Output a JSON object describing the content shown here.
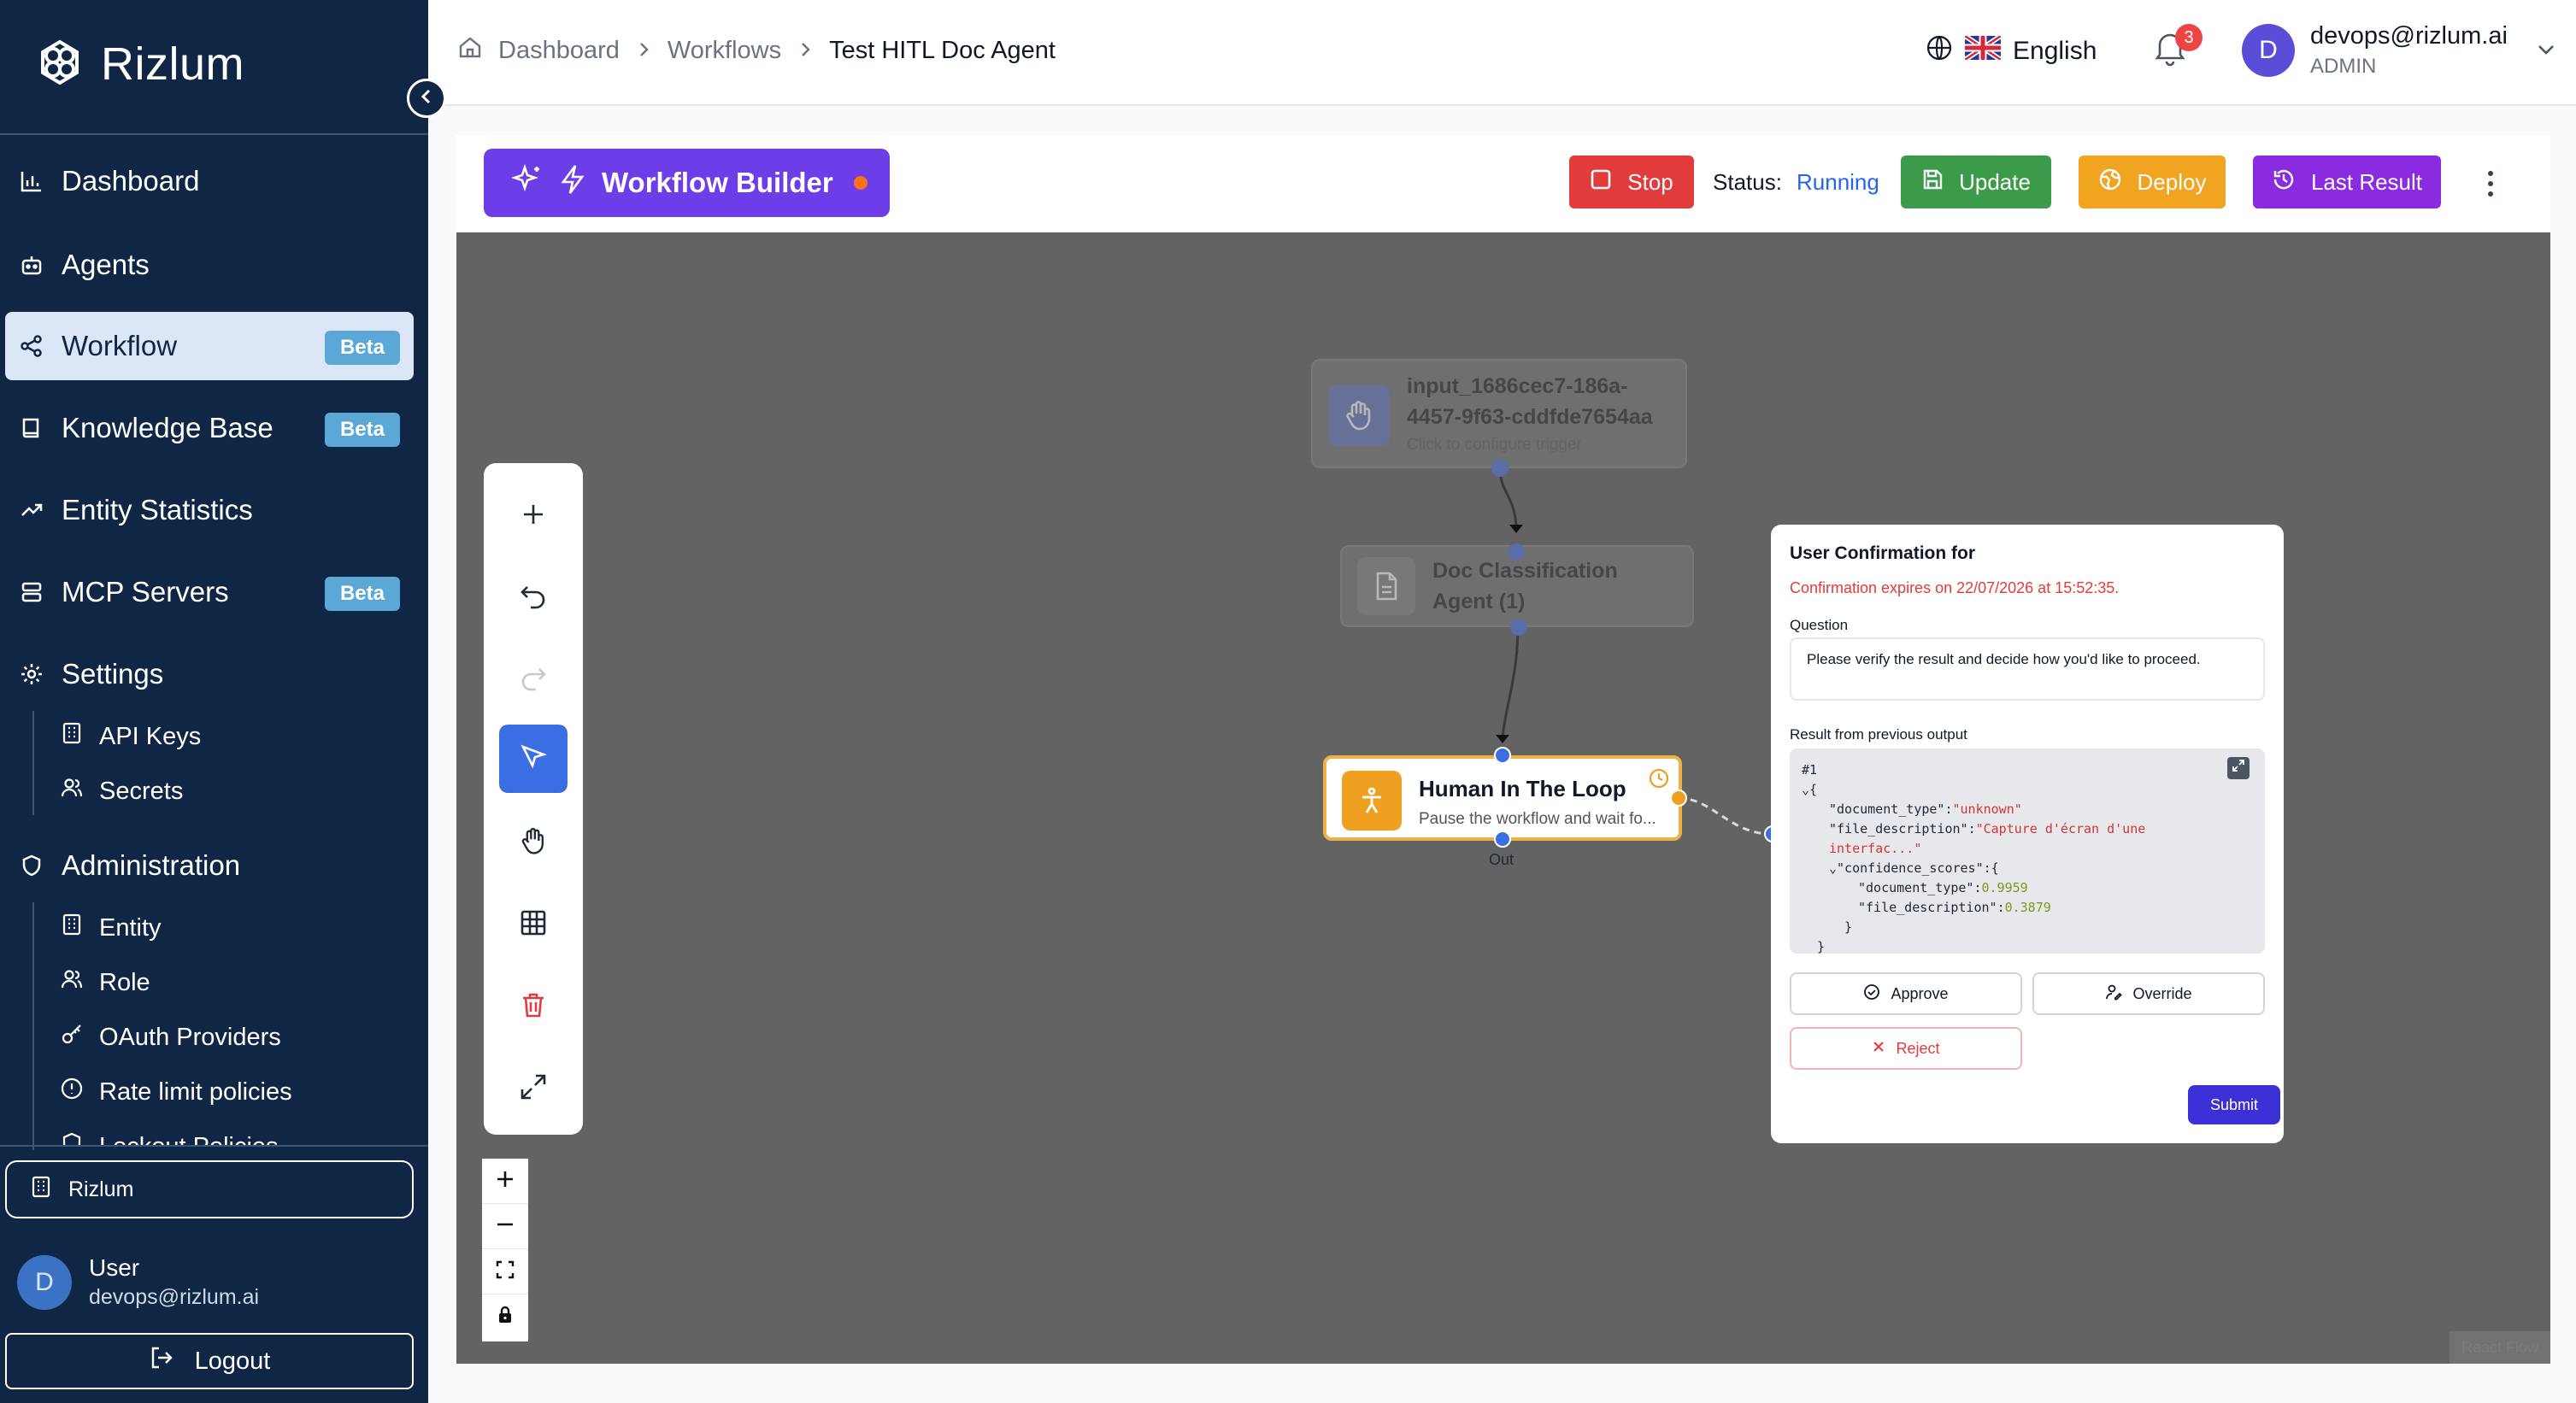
{
  "app": {
    "name": "Rizlum"
  },
  "sidebar": {
    "items": [
      {
        "label": "Dashboard",
        "icon": "bar-chart-icon"
      },
      {
        "label": "Agents",
        "icon": "bot-icon"
      },
      {
        "label": "Workflow",
        "icon": "share-nodes-icon",
        "badge": "Beta",
        "active": true
      },
      {
        "label": "Knowledge Base",
        "icon": "book-icon",
        "badge": "Beta"
      },
      {
        "label": "Entity Statistics",
        "icon": "trend-up-icon"
      },
      {
        "label": "MCP Servers",
        "icon": "server-icon",
        "badge": "Beta"
      },
      {
        "label": "Settings",
        "icon": "gear-icon"
      }
    ],
    "settings_sub": [
      {
        "label": "API Keys",
        "icon": "building-icon"
      },
      {
        "label": "Secrets",
        "icon": "users-icon"
      }
    ],
    "administration": {
      "label": "Administration",
      "icon": "shield-icon"
    },
    "admin_sub": [
      {
        "label": "Entity",
        "icon": "building-icon"
      },
      {
        "label": "Role",
        "icon": "users-icon"
      },
      {
        "label": "OAuth Providers",
        "icon": "key-icon"
      },
      {
        "label": "Rate limit policies",
        "icon": "alert-circle-icon"
      },
      {
        "label": "Lockout Policies",
        "icon": "shield-icon"
      }
    ],
    "org": "Rizlum",
    "user": {
      "initial": "D",
      "name": "User",
      "email": "devops@rizlum.ai"
    },
    "logout": "Logout"
  },
  "header": {
    "breadcrumb": [
      "Dashboard",
      "Workflows",
      "Test HITL Doc Agent"
    ],
    "language": "English",
    "notifications": "3",
    "account": {
      "initial": "D",
      "email": "devops@rizlum.ai",
      "role": "ADMIN"
    }
  },
  "builder": {
    "title": "Workflow Builder",
    "stop": "Stop",
    "status_label": "Status:",
    "status_value": "Running",
    "update": "Update",
    "deploy": "Deploy",
    "last_result": "Last Result"
  },
  "canvas": {
    "nodes": {
      "input": {
        "title_line1": "input_1686cec7-186a-",
        "title_line2": "4457-9f63-cddfde7654aa",
        "subtitle": "Click to configure trigger"
      },
      "doc": {
        "title_line1": "Doc Classification",
        "title_line2": "Agent (1)"
      },
      "hitl": {
        "title": "Human In The Loop",
        "subtitle": "Pause the workflow and wait fo...",
        "out_label": "Out"
      }
    },
    "attribution": "React Flow"
  },
  "confirmation": {
    "title": "User Confirmation for",
    "expiry": "Confirmation expires on 22/07/2026 at 15:52:35.",
    "question_label": "Question",
    "question": "Please verify the result and decide how you'd like to proceed.",
    "result_label": "Result from previous output",
    "result": {
      "index": "#1",
      "document_type_key": "\"document_type\"",
      "document_type_value": "\"unknown\"",
      "file_description_key": "\"file_description\"",
      "file_description_value_1": "\"Capture d'écran d'une",
      "file_description_value_2": "interfac...\"",
      "confidence_key": "\"confidence_scores\"",
      "cs_document_type_key": "\"document_type\"",
      "cs_document_type_value": "0.9959",
      "cs_file_description_key": "\"file_description\"",
      "cs_file_description_value": "0.3879"
    },
    "approve": "Approve",
    "override": "Override",
    "reject": "Reject",
    "submit": "Submit"
  },
  "colors": {
    "sidebar_bg": "#0f2744",
    "accent_purple": "#6d3ee8",
    "stop_red": "#e23b3b",
    "update_green": "#3b9b4a",
    "deploy_orange": "#f0a420",
    "last_result_purple": "#8a2be2",
    "canvas_bg": "#636363"
  }
}
